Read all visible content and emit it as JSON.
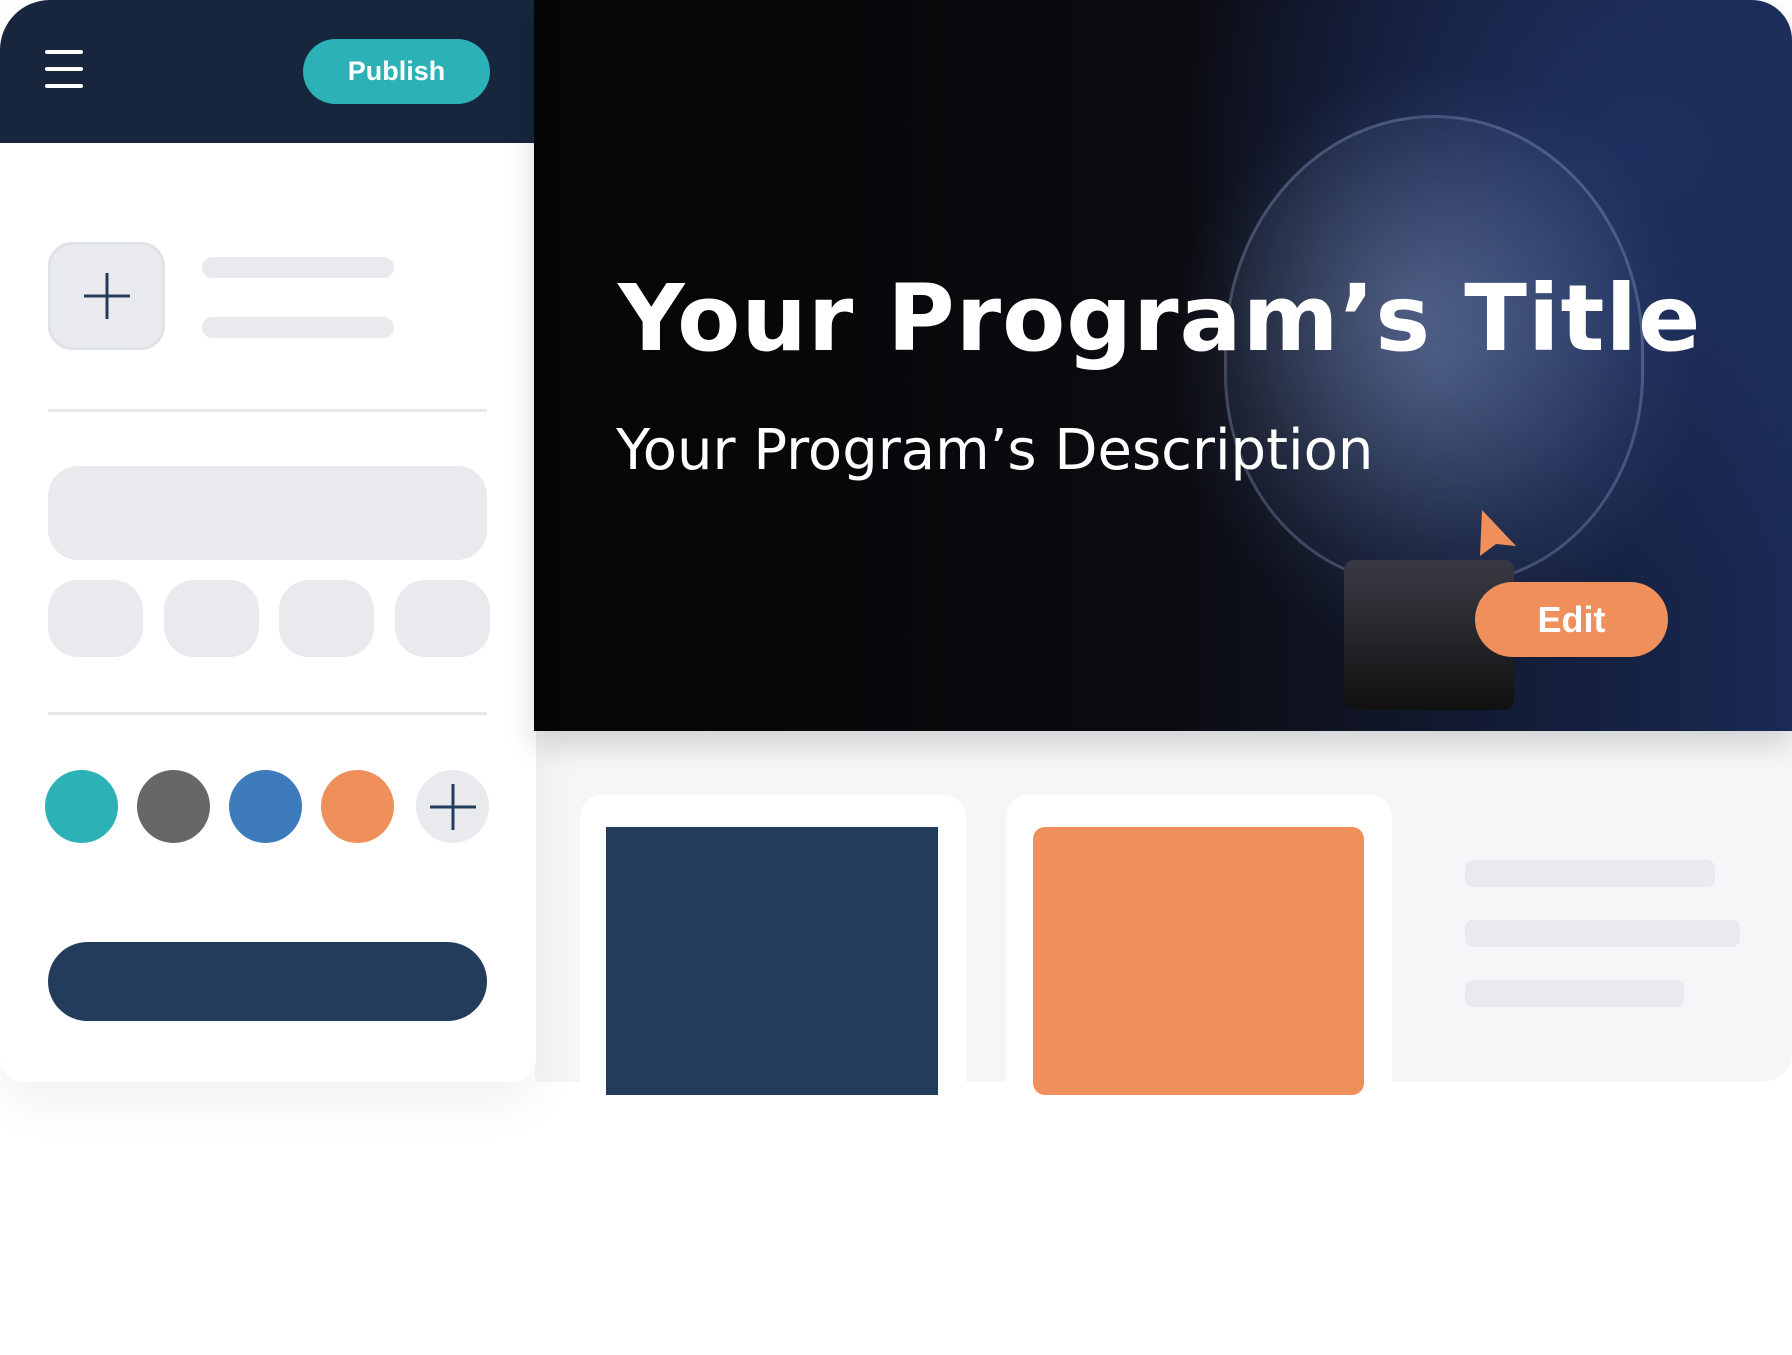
{
  "header": {
    "publish_label": "Publish",
    "menu_icon": "hamburger-menu-icon"
  },
  "hero": {
    "title": "Your Program’s Title",
    "description": "Your Program’s Description",
    "edit_label": "Edit"
  },
  "colors": {
    "navy": "#17263d",
    "teal": "#2bb1b6",
    "gray": "#676767",
    "blue": "#3d7bbd",
    "orange": "#ef8f5b",
    "dark_button": "#233c5b"
  },
  "palette": [
    "#2bb1b6",
    "#676767",
    "#3d7bbd",
    "#ef8f5b"
  ]
}
